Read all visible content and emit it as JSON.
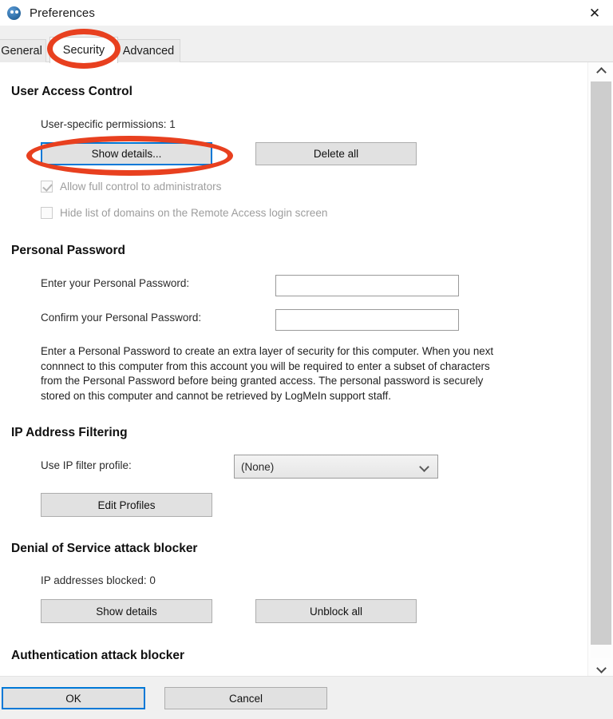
{
  "window": {
    "title": "Preferences",
    "icon": "logmein-icon",
    "close_label": "✕"
  },
  "tabs": [
    {
      "label": "General",
      "selected": false
    },
    {
      "label": "Security",
      "selected": true
    },
    {
      "label": "Advanced",
      "selected": false
    }
  ],
  "sections": {
    "user_access_control": {
      "heading": "User Access Control",
      "permissions_label": "User-specific permissions: 1",
      "show_details_button": "Show details...",
      "delete_all_button": "Delete all",
      "checkbox_admins": "Allow full control to administrators",
      "checkbox_hide_domains": "Hide list of domains on the Remote Access login screen"
    },
    "personal_password": {
      "heading": "Personal Password",
      "enter_label": "Enter your Personal Password:",
      "confirm_label": "Confirm your Personal Password:",
      "enter_value": "",
      "confirm_value": "",
      "description_line1": "Enter a Personal Password to create an extra layer of security for this computer. When you next",
      "description_line2": "connnect to this computer from this account you will be required to enter a subset of characters",
      "description_line3": "from the Personal Password before being granted access. The personal password is securely",
      "description_line4": "stored on this computer and cannot be retrieved by LogMeIn support staff."
    },
    "ip_address_filtering": {
      "heading": "IP Address Filtering",
      "profile_label": "Use IP filter profile:",
      "profile_value": "(None)",
      "edit_profiles_button": "Edit Profiles"
    },
    "dos_attack_blocker": {
      "heading": "Denial of Service attack blocker",
      "blocked_label": "IP addresses blocked: 0",
      "show_details_button": "Show details",
      "unblock_all_button": "Unblock all"
    },
    "auth_attack_blocker": {
      "heading": "Authentication attack blocker"
    }
  },
  "footer": {
    "ok_label": "OK",
    "cancel_label": "Cancel"
  },
  "scrollbar": {
    "up_arrow": "chevron-up-icon",
    "down_arrow": "chevron-down-icon"
  },
  "annotations": {
    "color": "#e8401f",
    "targets": [
      "security-tab",
      "show-details-button"
    ]
  }
}
